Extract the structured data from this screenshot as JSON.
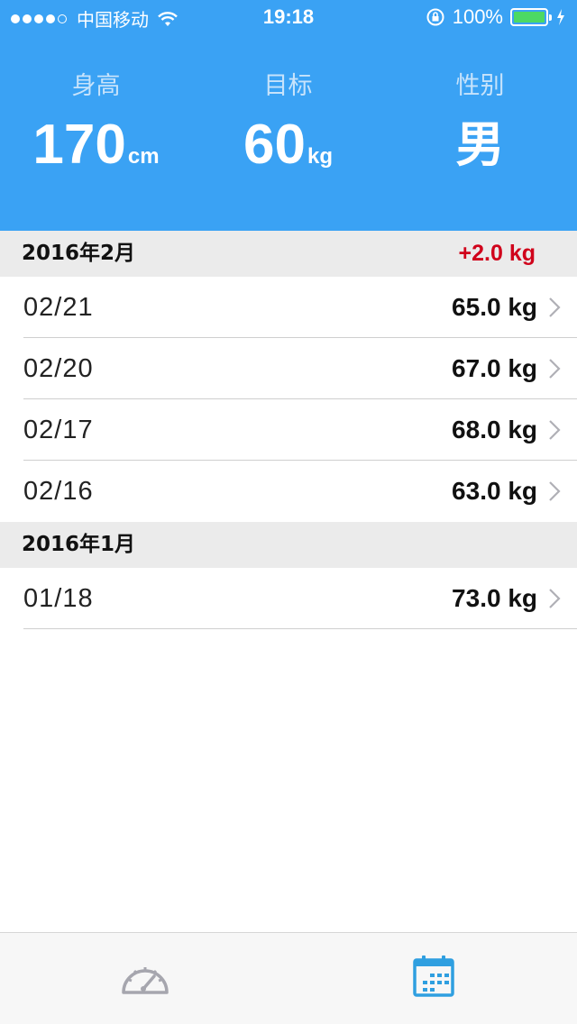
{
  "status_bar": {
    "carrier": "中国移动",
    "time": "19:18",
    "battery": "100%",
    "signal_bars": 4
  },
  "profile": {
    "height": {
      "label": "身高",
      "value": "170",
      "unit": "cm"
    },
    "target": {
      "label": "目标",
      "value": "60",
      "unit": "kg"
    },
    "gender": {
      "label": "性别",
      "value": "男"
    }
  },
  "sections": [
    {
      "title": "2016年2月",
      "delta": "+2.0 kg",
      "rows": [
        {
          "date": "02/21",
          "weight": "65.0 kg"
        },
        {
          "date": "02/20",
          "weight": "67.0 kg"
        },
        {
          "date": "02/17",
          "weight": "68.0 kg"
        },
        {
          "date": "02/16",
          "weight": "63.0 kg"
        }
      ]
    },
    {
      "title": "2016年1月",
      "delta": "",
      "rows": [
        {
          "date": "01/18",
          "weight": "73.0 kg"
        }
      ]
    }
  ],
  "tabbar": {
    "tabs": [
      {
        "icon": "speedometer-icon",
        "selected": false
      },
      {
        "icon": "calendar-icon",
        "selected": true
      }
    ]
  },
  "colors": {
    "header": "#3aa2f4",
    "delta": "#d0021b",
    "tab_selected": "#2f9fe0",
    "tab_unselected": "#a6a6ae"
  }
}
